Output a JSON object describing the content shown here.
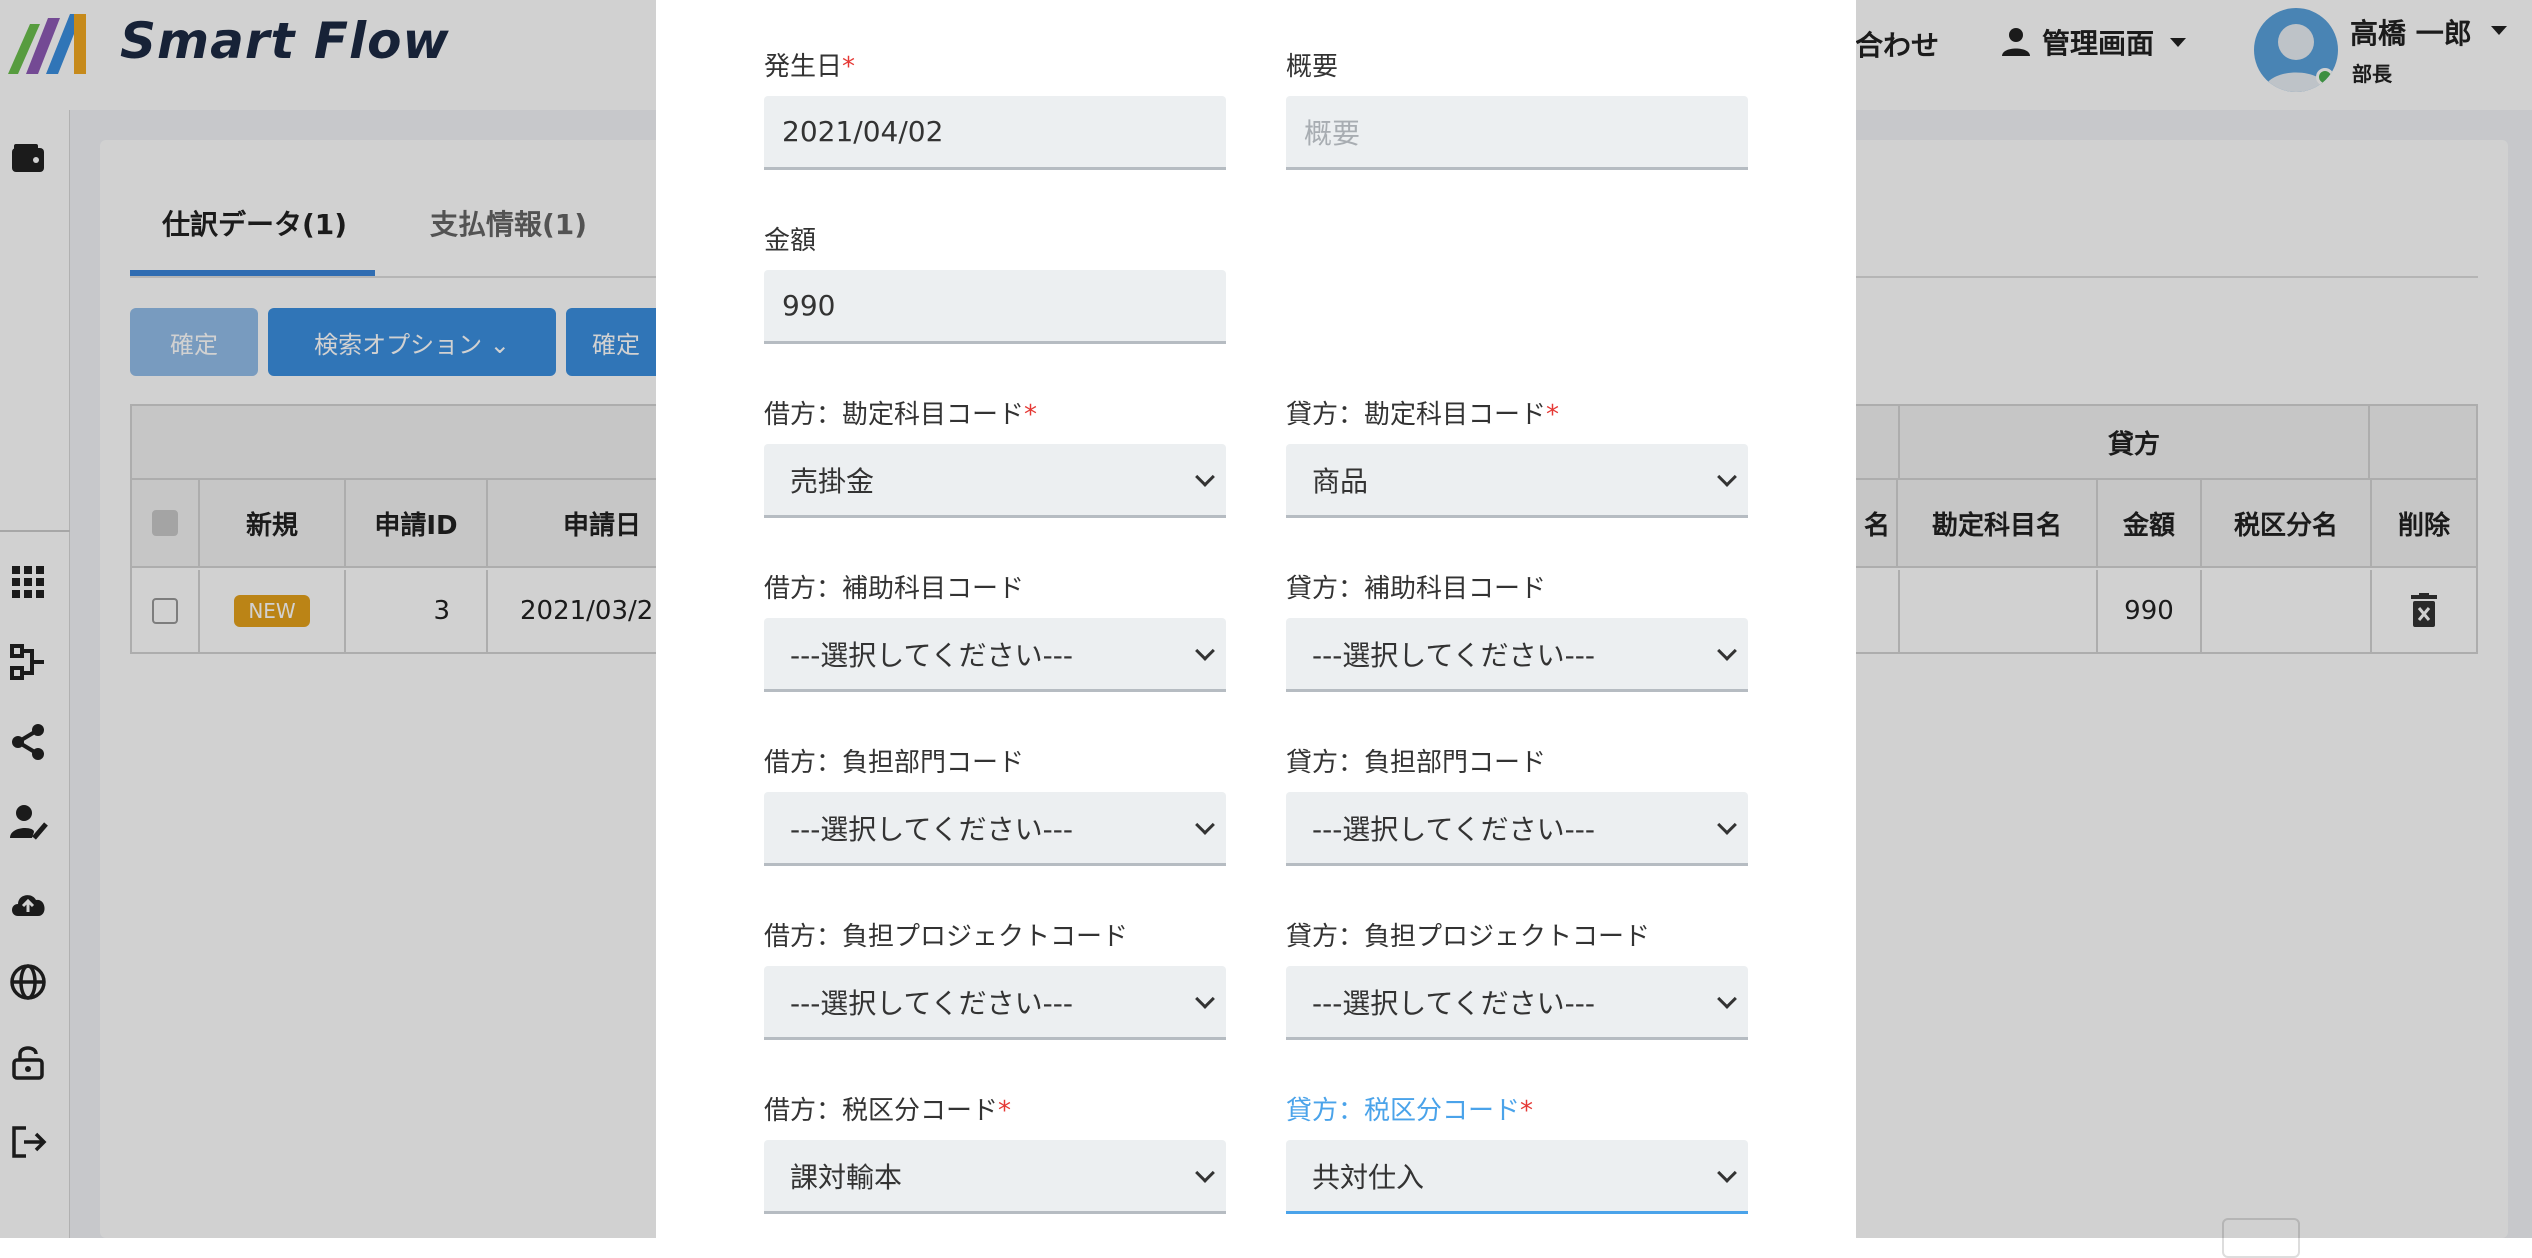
{
  "header": {
    "brand": "Smart Flow",
    "contact_partial": "合わせ",
    "admin_label": "管理画面",
    "user": {
      "name": "高橋 一郎",
      "role": "部長"
    }
  },
  "sidebar": {
    "icons": [
      "wallet-icon",
      "grid-icon",
      "workflow-icon",
      "share-icon",
      "user-edit-icon",
      "cloud-upload-icon",
      "globe-icon",
      "lock-open-icon",
      "logout-icon"
    ]
  },
  "tabs": [
    {
      "label": "仕訳データ(1)"
    },
    {
      "label": "支払情報(1)"
    }
  ],
  "toolbar": {
    "confirm": "確定",
    "search_options": "検索オプション ⌄",
    "confirm_partial": "確定"
  },
  "table": {
    "group_header_credit": "貸方",
    "headers_left": [
      "新規",
      "申請ID",
      "申請日"
    ],
    "headers_right_partial": "名",
    "headers_right": [
      "勘定科目名",
      "金額",
      "税区分名",
      "削除"
    ],
    "row": {
      "badge": "NEW",
      "id": "3",
      "date": "2021/03/2",
      "amount": "990"
    }
  },
  "modal": {
    "fields": {
      "date": {
        "label": "発生日",
        "required": "*",
        "value": "2021/04/02"
      },
      "summary": {
        "label": "概要",
        "placeholder": "概要"
      },
      "amount": {
        "label": "金額",
        "value": "990"
      },
      "debit_account": {
        "label": "借方：勘定科目コード",
        "required": "*",
        "value": "売掛金"
      },
      "credit_account": {
        "label": "貸方：勘定科目コード",
        "required": "*",
        "value": "商品"
      },
      "debit_sub": {
        "label": "借方：補助科目コード",
        "value": "---選択してください---"
      },
      "credit_sub": {
        "label": "貸方：補助科目コード",
        "value": "---選択してください---"
      },
      "debit_dept": {
        "label": "借方：負担部門コード",
        "value": "---選択してください---"
      },
      "credit_dept": {
        "label": "貸方：負担部門コード",
        "value": "---選択してください---"
      },
      "debit_project": {
        "label": "借方：負担プロジェクトコード",
        "value": "---選択してください---"
      },
      "credit_project": {
        "label": "貸方：負担プロジェクトコード",
        "value": "---選択してください---"
      },
      "debit_tax": {
        "label": "借方：税区分コード",
        "required": "*",
        "value": "課対輸本"
      },
      "credit_tax": {
        "label": "貸方：税区分コード",
        "required": "*",
        "value": "共対仕入"
      }
    }
  },
  "colors": {
    "accent": "#3b8fe0",
    "focus": "#4aa3ea",
    "required": "#e53935",
    "badge": "#e4a11b"
  }
}
